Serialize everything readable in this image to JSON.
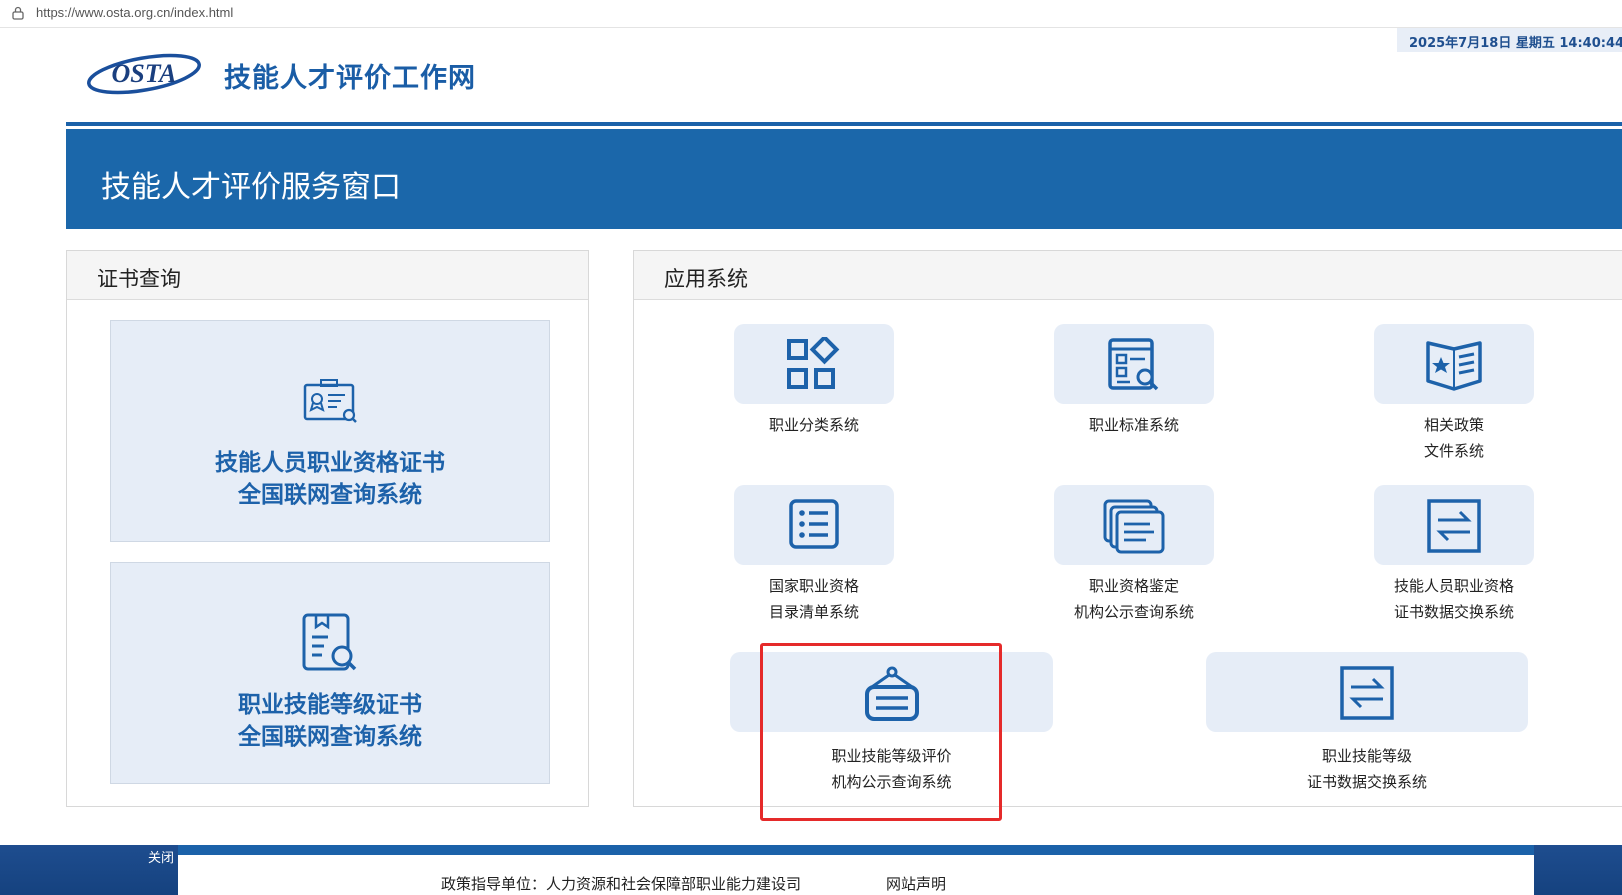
{
  "browser": {
    "url": "https://www.osta.org.cn/index.html"
  },
  "header": {
    "logo_text": "OSTA",
    "site_title": "技能人才评价工作网",
    "datetime": "2025年7月18日    星期五 14:40:44"
  },
  "banner": {
    "title": "技能人才评价服务窗口"
  },
  "cert_panel": {
    "title": "证书查询",
    "cards": [
      {
        "line1": "技能人员职业资格证书",
        "line2": "全国联网查询系统"
      },
      {
        "line1": "职业技能等级证书",
        "line2": "全国联网查询系统"
      }
    ]
  },
  "apps_panel": {
    "title": "应用系统",
    "items": [
      {
        "line1": "职业分类系统",
        "line2": ""
      },
      {
        "line1": "职业标准系统",
        "line2": ""
      },
      {
        "line1": "相关政策",
        "line2": "文件系统"
      },
      {
        "line1": "国家职业资格",
        "line2": "目录清单系统"
      },
      {
        "line1": "职业资格鉴定",
        "line2": "机构公示查询系统"
      },
      {
        "line1": "技能人员职业资格",
        "line2": "证书数据交换系统"
      },
      {
        "line1": "职业技能等级评价",
        "line2": "机构公示查询系统"
      },
      {
        "line1": "职业技能等级",
        "line2": "证书数据交换系统"
      }
    ]
  },
  "footer": {
    "close_label": "关闭",
    "guide": "政策指导单位：人力资源和社会保障部职业能力建设司",
    "statement": "网站声明"
  },
  "colors": {
    "brand_blue": "#1b67aa",
    "tile_bg": "#e6edf7",
    "highlight_red": "#e52a2a"
  }
}
